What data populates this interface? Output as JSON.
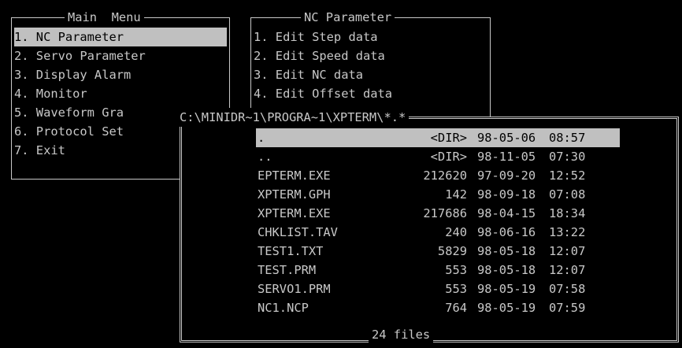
{
  "main_menu": {
    "title": "Main  Menu",
    "items": [
      {
        "label": "1. NC Parameter",
        "selected": true
      },
      {
        "label": "2. Servo Parameter",
        "selected": false
      },
      {
        "label": "3. Display Alarm",
        "selected": false
      },
      {
        "label": "4. Monitor",
        "selected": false
      },
      {
        "label": "5. Waveform Gra",
        "selected": false
      },
      {
        "label": "6. Protocol Set",
        "selected": false
      },
      {
        "label": "7. Exit",
        "selected": false
      }
    ]
  },
  "nc_menu": {
    "title": "NC Parameter",
    "items": [
      {
        "label": "1. Edit Step data"
      },
      {
        "label": "2. Edit Speed data"
      },
      {
        "label": "3. Edit NC data"
      },
      {
        "label": "4. Edit Offset data"
      }
    ]
  },
  "file_dialog": {
    "path": "C:\\MINIDR~1\\PROGRA~1\\XPTERM\\*.*",
    "footer": "24 files",
    "files": [
      {
        "name": ".",
        "size": "<DIR>",
        "date": "98-05-06",
        "time": "08:57",
        "selected": true
      },
      {
        "name": "..",
        "size": "<DIR>",
        "date": "98-11-05",
        "time": "07:30",
        "selected": false
      },
      {
        "name": "EPTERM.EXE",
        "size": "212620",
        "date": "97-09-20",
        "time": "12:52",
        "selected": false
      },
      {
        "name": "XPTERM.GPH",
        "size": "142",
        "date": "98-09-18",
        "time": "07:08",
        "selected": false
      },
      {
        "name": "XPTERM.EXE",
        "size": "217686",
        "date": "98-04-15",
        "time": "18:34",
        "selected": false
      },
      {
        "name": "CHKLIST.TAV",
        "size": "240",
        "date": "98-06-16",
        "time": "13:22",
        "selected": false
      },
      {
        "name": "TEST1.TXT",
        "size": "5829",
        "date": "98-05-18",
        "time": "12:07",
        "selected": false
      },
      {
        "name": "TEST.PRM",
        "size": "553",
        "date": "98-05-18",
        "time": "12:07",
        "selected": false
      },
      {
        "name": "SERVO1.PRM",
        "size": "553",
        "date": "98-05-19",
        "time": "07:58",
        "selected": false
      },
      {
        "name": "NC1.NCP",
        "size": "764",
        "date": "98-05-19",
        "time": "07:59",
        "selected": false
      }
    ]
  },
  "colors": {
    "background": "#000000",
    "foreground": "#c8c8c8",
    "highlight_bg": "#c0c0c0",
    "highlight_fg": "#000000"
  }
}
